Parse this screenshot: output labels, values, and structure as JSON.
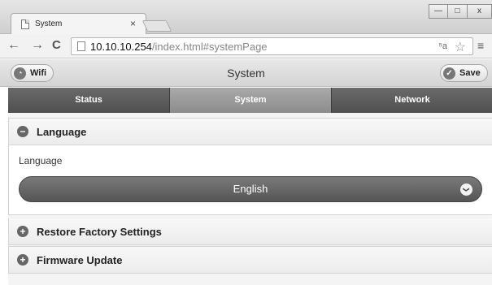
{
  "browser": {
    "tab_title": "System",
    "tab_close": "×",
    "window_controls": {
      "minimize": "—",
      "maximize": "□",
      "close": "x"
    },
    "url_host": "10.10.10.254",
    "url_path": "/index.html#systemPage",
    "nav": {
      "back": "←",
      "forward": "→",
      "reload": "C"
    },
    "icons": {
      "page": "page-icon",
      "translate": "translate-icon",
      "star": "star-icon",
      "menu": "menu-icon"
    },
    "translate_glyph": "⁵a",
    "star_glyph": "☆",
    "menu_glyph": "≡"
  },
  "header": {
    "wifi_label": "Wifi",
    "title": "System",
    "save_label": "Save"
  },
  "tabs": [
    {
      "label": "Status",
      "active": false
    },
    {
      "label": "System",
      "active": true
    },
    {
      "label": "Network",
      "active": false
    }
  ],
  "sections": {
    "language": {
      "title": "Language",
      "expanded": true,
      "field_label": "Language",
      "selected": "English"
    },
    "restore": {
      "title": "Restore Factory Settings",
      "expanded": false
    },
    "firmware": {
      "title": "Firmware Update",
      "expanded": false
    }
  },
  "icon_glyphs": {
    "minus": "−",
    "plus": "+",
    "chevron_down": "❯",
    "check": "✓",
    "wifi": "◔"
  }
}
